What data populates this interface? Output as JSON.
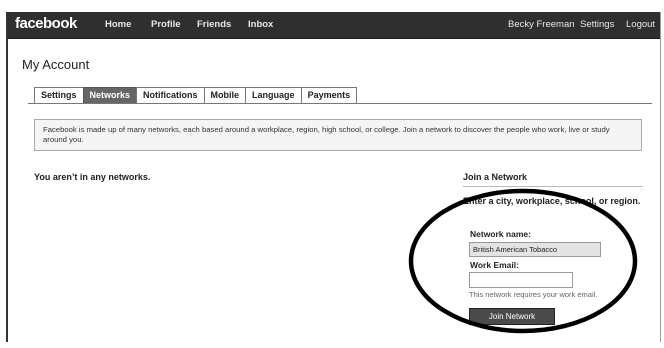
{
  "header": {
    "logo": "facebook",
    "nav": [
      "Home",
      "Profile",
      "Friends",
      "Inbox"
    ],
    "user_name": "Becky Freeman",
    "settings": "Settings",
    "logout": "Logout"
  },
  "page_title": "My Account",
  "tabs": [
    {
      "label": "Settings",
      "active": false
    },
    {
      "label": "Networks",
      "active": true
    },
    {
      "label": "Notifications",
      "active": false
    },
    {
      "label": "Mobile",
      "active": false
    },
    {
      "label": "Language",
      "active": false
    },
    {
      "label": "Payments",
      "active": false
    }
  ],
  "info_text": "Facebook is made up of many networks, each based around a workplace, region, high school, or college. Join a network to discover the people who work, live or study around you.",
  "no_networks_text": "You aren’t in any networks.",
  "join": {
    "heading": "Join a Network",
    "prompt": "Enter a city, workplace, school, or region.",
    "network_label": "Network name:",
    "network_value": "British American Tobacco",
    "email_label": "Work Email:",
    "email_value": "",
    "hint": "This network requires your work email.",
    "button": "Join Network"
  },
  "colors": {
    "topbar": "#2f2f2f",
    "active_tab": "#666666",
    "button": "#4a4a4a"
  }
}
